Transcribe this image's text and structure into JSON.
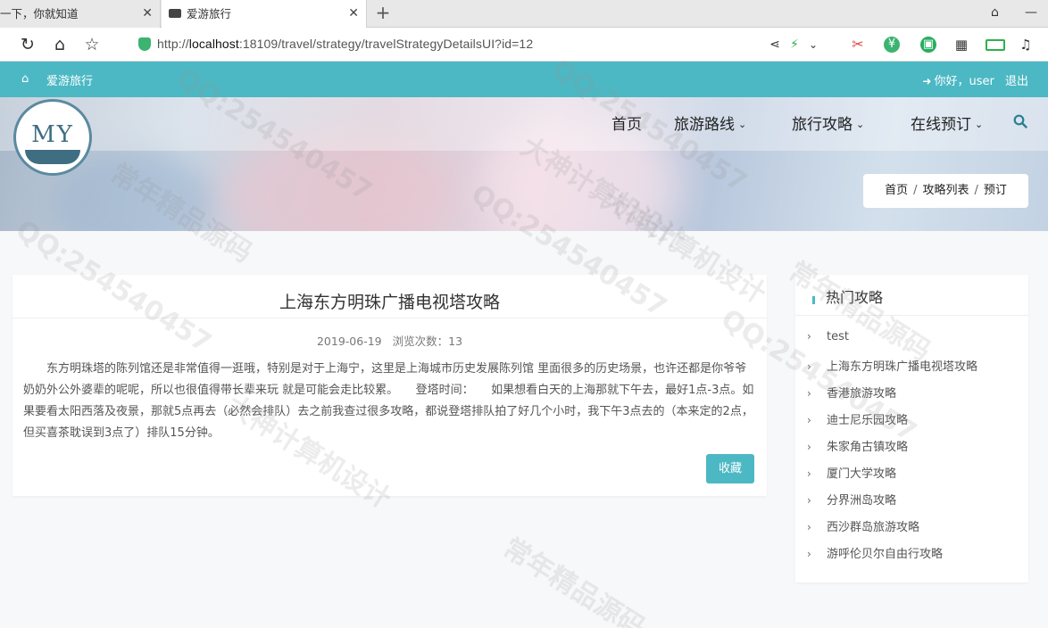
{
  "browser": {
    "tabs": [
      {
        "label": "一下，你就知道"
      },
      {
        "label": "爱游旅行"
      }
    ],
    "url_prefix": "http://",
    "url_host": "localhost",
    "url_rest": ":18109/travel/strategy/travelStrategyDetailsUI?id=12"
  },
  "topbar": {
    "brand": "爱游旅行",
    "greeting": "你好，user",
    "logout": "退出"
  },
  "logo": {
    "text": "MY"
  },
  "nav": {
    "items": [
      "首页",
      "旅游路线",
      "旅行攻略",
      "在线预订"
    ]
  },
  "breadcrumb": [
    "首页",
    "攻略列表",
    "预订"
  ],
  "article": {
    "title": "上海东方明珠广播电视塔攻略",
    "date": "2019-06-19",
    "views_label": "浏览次数：",
    "views": "13",
    "body": "东方明珠塔的陈列馆还是非常值得一逛哦，特别是对于上海宁，这里是上海城市历史发展陈列馆 里面很多的历史场景，也许还都是你爷爷奶奶外公外婆辈的呢呢，所以也很值得带长辈来玩 就是可能会走比较累。　　登塔时间：　　如果想看白天的上海那就下午去，最好1点-3点。如果要看太阳西落及夜景，那就5点再去（必然会排队）去之前我查过很多攻略，都说登塔排队拍了好几个小时，我下午3点去的（本来定的2点，但买喜茶耽误到3点了）排队15分钟。",
    "fav_button": "收藏"
  },
  "sidebar": {
    "title": "热门攻略",
    "items": [
      "test",
      "上海东方明珠广播电视塔攻略",
      "香港旅游攻略",
      "迪士尼乐园攻略",
      "朱家角古镇攻略",
      "厦门大学攻略",
      "分界洲岛攻略",
      "西沙群岛旅游攻略",
      "游呼伦贝尔自由行攻略"
    ]
  },
  "watermark": [
    "QQ:254540457",
    "常年精品源码",
    "大神计算机设计"
  ],
  "colors": {
    "accent": "#4cb8c4"
  }
}
